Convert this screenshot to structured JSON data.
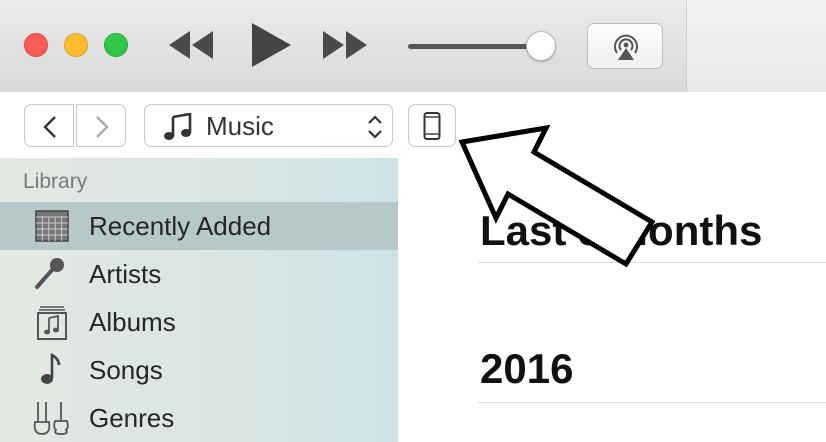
{
  "window": {
    "controls": {
      "close": "close-window-button",
      "minimize": "minimize-window-button",
      "maximize": "maximize-window-button"
    },
    "colors": {
      "close": "#fc5b57",
      "minimize": "#fdbc2e",
      "maximize": "#33c748"
    }
  },
  "player": {
    "rewind_icon": "rewind-icon",
    "play_icon": "play-icon",
    "fast_forward_icon": "fast-forward-icon",
    "volume_level": 0.87,
    "airplay_icon": "airplay-icon"
  },
  "navbar": {
    "back_icon": "chevron-left-icon",
    "forward_icon": "chevron-right-icon",
    "media_kind": "Music",
    "media_icon": "music-note-icon",
    "device_icon": "iphone-icon"
  },
  "sidebar": {
    "header": "Library",
    "items": [
      {
        "label": "Recently Added",
        "icon": "grid-calendar-icon",
        "selected": true
      },
      {
        "label": "Artists",
        "icon": "microphone-icon",
        "selected": false
      },
      {
        "label": "Albums",
        "icon": "album-icon",
        "selected": false
      },
      {
        "label": "Songs",
        "icon": "music-note-icon",
        "selected": false
      },
      {
        "label": "Genres",
        "icon": "guitar-violin-icon",
        "selected": false
      }
    ]
  },
  "main": {
    "sections": [
      {
        "title": "Last 3 Months"
      },
      {
        "title": "2016"
      }
    ]
  },
  "annotation": {
    "type": "arrow",
    "points_to": "device-button",
    "color": "#000000"
  }
}
